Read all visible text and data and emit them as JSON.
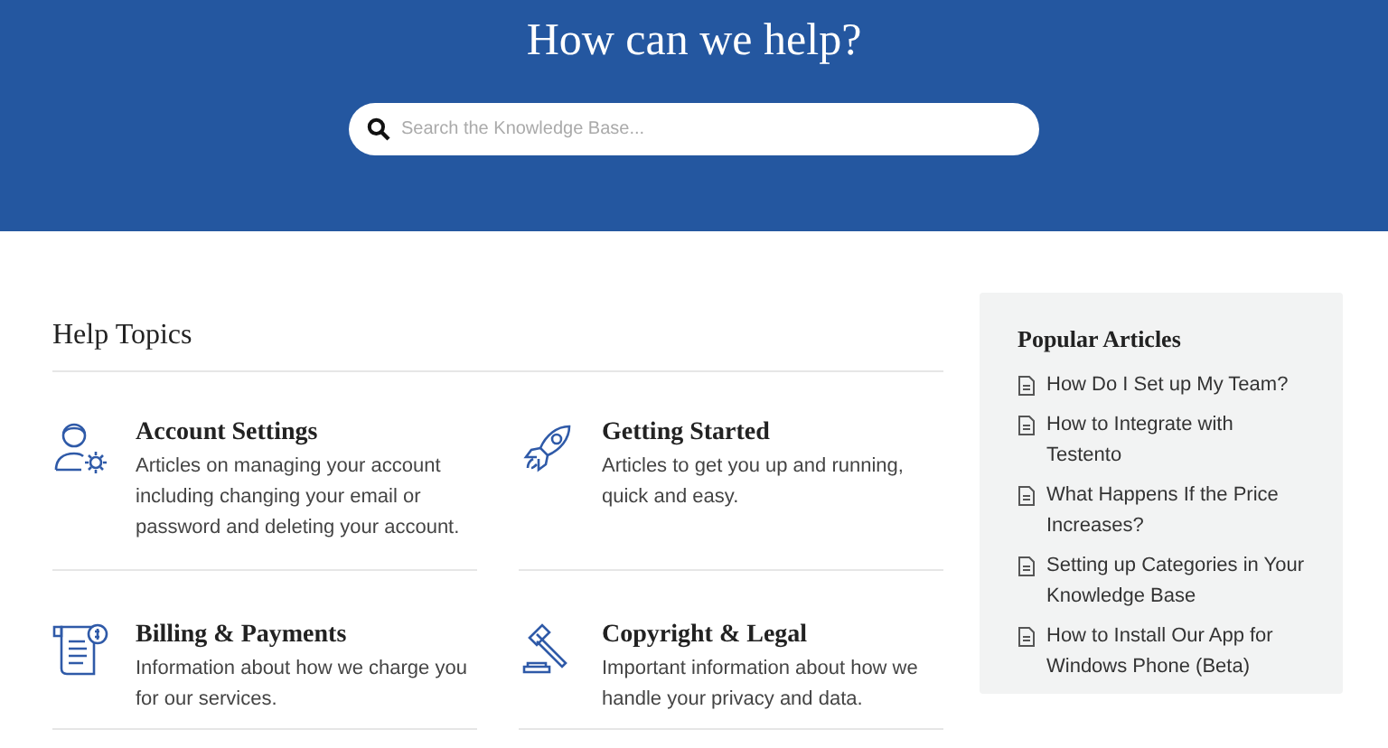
{
  "header": {
    "title": "How can we help?",
    "search": {
      "placeholder": "Search the Knowledge Base..."
    }
  },
  "help_topics": {
    "title": "Help Topics",
    "topics": [
      {
        "title": "Account Settings",
        "description": "Articles on managing your account including changing your email or password and deleting your account."
      },
      {
        "title": "Getting Started",
        "description": "Articles to get you up and running, quick and easy."
      },
      {
        "title": "Billing & Payments",
        "description": "Information about how we charge you for our services."
      },
      {
        "title": "Copyright & Legal",
        "description": "Important information about how we handle your privacy and data."
      }
    ]
  },
  "popular_articles": {
    "title": "Popular Articles",
    "items": [
      "How Do I Set up My Team?",
      "How to Integrate with Testento",
      "What Happens If the Price Increases?",
      "Setting up Categories in Your Knowledge Base",
      "How to Install Our App for Windows Phone (Beta)"
    ]
  }
}
